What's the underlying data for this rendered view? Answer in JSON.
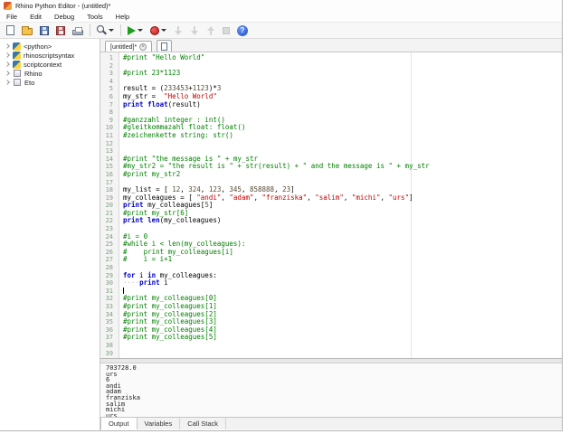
{
  "window": {
    "title": "Rhino Python Editor - (untitled)*"
  },
  "menu": {
    "items": [
      "File",
      "Edit",
      "Debug",
      "Tools",
      "Help"
    ]
  },
  "toolbar": {
    "items": [
      {
        "icon": "new-file-icon"
      },
      {
        "icon": "open-folder-icon"
      },
      {
        "icon": "save-icon"
      },
      {
        "icon": "save-all-icon"
      },
      {
        "icon": "print-icon"
      },
      {
        "sep": true
      },
      {
        "icon": "search-icon",
        "dropdown": true
      },
      {
        "sep": true
      },
      {
        "icon": "run-icon",
        "dropdown": true
      },
      {
        "icon": "debug-icon",
        "dropdown": true
      },
      {
        "icon": "step-into-icon",
        "disabled": true
      },
      {
        "icon": "step-over-icon",
        "disabled": true
      },
      {
        "icon": "step-out-icon",
        "disabled": true
      },
      {
        "icon": "stop-icon",
        "disabled": true
      },
      {
        "icon": "help-icon"
      }
    ]
  },
  "sidebar": {
    "items": [
      {
        "label": "<python>",
        "icon": "python-module-icon"
      },
      {
        "label": "rhinoscriptsyntax",
        "icon": "python-module-icon"
      },
      {
        "label": "scriptcontext",
        "icon": "python-module-icon"
      },
      {
        "label": "Rhino",
        "icon": "namespace-icon"
      },
      {
        "label": "Eto",
        "icon": "namespace-icon"
      }
    ]
  },
  "editor": {
    "tab_label": "[untitled]*",
    "caret_line": 31,
    "lines": [
      [
        [
          "c",
          "#print \"Hello World\""
        ]
      ],
      [],
      [
        [
          "c",
          "#print 23*1123"
        ]
      ],
      [],
      [
        [
          "p",
          "result = ("
        ],
        [
          "n",
          "233453"
        ],
        [
          "p",
          "+"
        ],
        [
          "n",
          "1123"
        ],
        [
          "p",
          ")*"
        ],
        [
          "n",
          "3"
        ]
      ],
      [
        [
          "p",
          "my_str =  "
        ],
        [
          "s",
          "\"Hello World\""
        ]
      ],
      [
        [
          "k",
          "print"
        ],
        [
          "p",
          " "
        ],
        [
          "k",
          "float"
        ],
        [
          "p",
          "(result)"
        ]
      ],
      [],
      [
        [
          "c",
          "#ganzzahl integer : int()"
        ]
      ],
      [
        [
          "c",
          "#gleitkommazahl float: float()"
        ]
      ],
      [
        [
          "c",
          "#zeichenkette string: str()"
        ]
      ],
      [],
      [],
      [
        [
          "c",
          "#print \"the message is \" + my_str"
        ]
      ],
      [
        [
          "c",
          "#my_str2 = \"the result is \" + str(result) + \" and the message is \" + my_str"
        ]
      ],
      [
        [
          "c",
          "#print my_str2"
        ]
      ],
      [],
      [
        [
          "p",
          "my_list = [ "
        ],
        [
          "n",
          "12"
        ],
        [
          "p",
          ", "
        ],
        [
          "n",
          "324"
        ],
        [
          "p",
          ", "
        ],
        [
          "n",
          "123"
        ],
        [
          "p",
          ", "
        ],
        [
          "n",
          "345"
        ],
        [
          "p",
          ", "
        ],
        [
          "n",
          "858888"
        ],
        [
          "p",
          ", "
        ],
        [
          "n",
          "23"
        ],
        [
          "p",
          "]"
        ]
      ],
      [
        [
          "p",
          "my_colleagues = [ "
        ],
        [
          "s",
          "\"andi\""
        ],
        [
          "p",
          ", "
        ],
        [
          "s",
          "\"adam\""
        ],
        [
          "p",
          ", "
        ],
        [
          "s",
          "\"franziska\""
        ],
        [
          "p",
          ", "
        ],
        [
          "s",
          "\"salim\""
        ],
        [
          "p",
          ", "
        ],
        [
          "s",
          "\"michi\""
        ],
        [
          "p",
          ", "
        ],
        [
          "s",
          "\"urs\""
        ],
        [
          "p",
          "]"
        ]
      ],
      [
        [
          "k",
          "print"
        ],
        [
          "p",
          " my_colleagues["
        ],
        [
          "n",
          "5"
        ],
        [
          "p",
          "]"
        ]
      ],
      [
        [
          "c",
          "#print my_str[6]"
        ]
      ],
      [
        [
          "k",
          "print"
        ],
        [
          "p",
          " "
        ],
        [
          "k",
          "len"
        ],
        [
          "p",
          "(my_colleagues)"
        ]
      ],
      [],
      [
        [
          "c",
          "#i = 0"
        ]
      ],
      [
        [
          "c",
          "#while i < len(my_colleagues):"
        ]
      ],
      [
        [
          "c",
          "#    print my_colleagues[i]"
        ]
      ],
      [
        [
          "c",
          "#    i = i+1"
        ]
      ],
      [],
      [
        [
          "k",
          "for"
        ],
        [
          "p",
          " i "
        ],
        [
          "k",
          "in"
        ],
        [
          "p",
          " my_colleagues:"
        ]
      ],
      [
        [
          "w",
          "····"
        ],
        [
          "k",
          "print"
        ],
        [
          "p",
          " i"
        ]
      ],
      [],
      [
        [
          "c",
          "#print my_colleagues[0]"
        ]
      ],
      [
        [
          "c",
          "#print my_colleagues[1]"
        ]
      ],
      [
        [
          "c",
          "#print my_colleagues[2]"
        ]
      ],
      [
        [
          "c",
          "#print my_colleagues[3]"
        ]
      ],
      [
        [
          "c",
          "#print my_colleagues[4]"
        ]
      ],
      [
        [
          "c",
          "#print my_colleagues[5]"
        ]
      ],
      [],
      []
    ]
  },
  "output": {
    "lines": [
      "703728.0",
      "urs",
      "6",
      "andi",
      "adam",
      "franziska",
      "salim",
      "michi",
      "urs"
    ],
    "tabs": [
      "Output",
      "Variables",
      "Call Stack"
    ],
    "active_tab": "Output"
  },
  "colors": {
    "comment": "#008000",
    "keyword": "#0000c8",
    "string": "#c00000",
    "number": "#554a33",
    "line_number": "#7f9f7f",
    "run_button": "#1e9e1e",
    "debug_button": "#c01818"
  }
}
